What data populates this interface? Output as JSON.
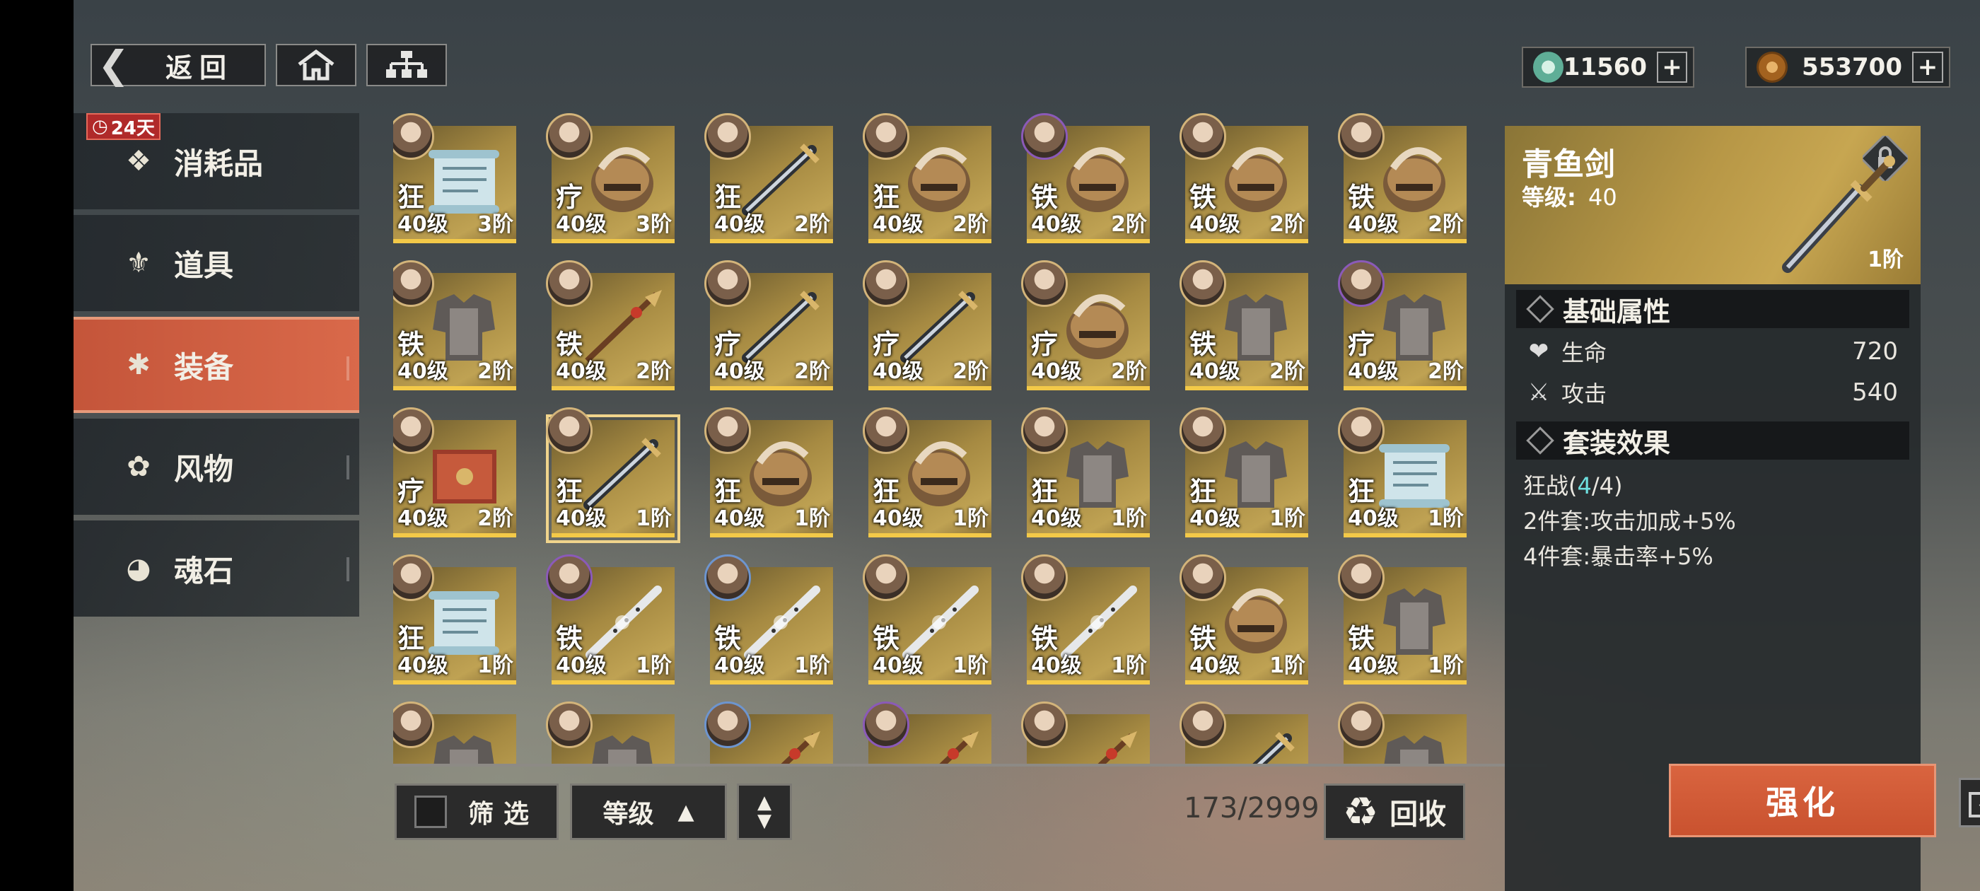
{
  "topbar": {
    "back_label": "返回"
  },
  "currencies": [
    {
      "icon": "jade-icon",
      "value": "11560"
    },
    {
      "icon": "coin-icon",
      "value": "553700"
    }
  ],
  "sidebar": {
    "timer_badge": "24天",
    "items": [
      {
        "label": "消耗品",
        "icon": "consumables-icon"
      },
      {
        "label": "道具",
        "icon": "props-icon"
      },
      {
        "label": "装备",
        "icon": "equipment-icon",
        "active": true
      },
      {
        "label": "风物",
        "icon": "scenery-icon"
      },
      {
        "label": "魂石",
        "icon": "soulstone-icon"
      }
    ]
  },
  "grid": {
    "cards": [
      {
        "set": "狂",
        "level": "40级",
        "tier": "3阶",
        "item": "scroll"
      },
      {
        "set": "疗",
        "level": "40级",
        "tier": "3阶",
        "item": "helmet"
      },
      {
        "set": "狂",
        "level": "40级",
        "tier": "2阶",
        "item": "sword"
      },
      {
        "set": "狂",
        "level": "40级",
        "tier": "2阶",
        "item": "helmet"
      },
      {
        "set": "铁",
        "level": "40级",
        "tier": "2阶",
        "item": "helmet"
      },
      {
        "set": "铁",
        "level": "40级",
        "tier": "2阶",
        "item": "helmet"
      },
      {
        "set": "铁",
        "level": "40级",
        "tier": "2阶",
        "item": "helmet"
      },
      {
        "set": "铁",
        "level": "40级",
        "tier": "2阶",
        "item": "armor"
      },
      {
        "set": "铁",
        "level": "40级",
        "tier": "2阶",
        "item": "spear"
      },
      {
        "set": "疗",
        "level": "40级",
        "tier": "2阶",
        "item": "sword"
      },
      {
        "set": "疗",
        "level": "40级",
        "tier": "2阶",
        "item": "sword"
      },
      {
        "set": "疗",
        "level": "40级",
        "tier": "2阶",
        "item": "helmet"
      },
      {
        "set": "铁",
        "level": "40级",
        "tier": "2阶",
        "item": "armor"
      },
      {
        "set": "疗",
        "level": "40级",
        "tier": "2阶",
        "item": "armor"
      },
      {
        "set": "疗",
        "level": "40级",
        "tier": "2阶",
        "item": "book"
      },
      {
        "set": "狂",
        "level": "40级",
        "tier": "1阶",
        "item": "sword",
        "selected": true
      },
      {
        "set": "狂",
        "level": "40级",
        "tier": "1阶",
        "item": "helmet"
      },
      {
        "set": "狂",
        "level": "40级",
        "tier": "1阶",
        "item": "helmet"
      },
      {
        "set": "狂",
        "level": "40级",
        "tier": "1阶",
        "item": "armor"
      },
      {
        "set": "狂",
        "level": "40级",
        "tier": "1阶",
        "item": "armor"
      },
      {
        "set": "狂",
        "level": "40级",
        "tier": "1阶",
        "item": "scroll"
      },
      {
        "set": "狂",
        "level": "40级",
        "tier": "1阶",
        "item": "scroll"
      },
      {
        "set": "铁",
        "level": "40级",
        "tier": "1阶",
        "item": "flute"
      },
      {
        "set": "铁",
        "level": "40级",
        "tier": "1阶",
        "item": "flute"
      },
      {
        "set": "铁",
        "level": "40级",
        "tier": "1阶",
        "item": "flute"
      },
      {
        "set": "铁",
        "level": "40级",
        "tier": "1阶",
        "item": "flute"
      },
      {
        "set": "铁",
        "level": "40级",
        "tier": "1阶",
        "item": "helmet"
      },
      {
        "set": "铁",
        "level": "40级",
        "tier": "1阶",
        "item": "armor"
      },
      {
        "set": "",
        "level": "",
        "tier": "",
        "item": "armor"
      },
      {
        "set": "",
        "level": "",
        "tier": "",
        "item": "armor"
      },
      {
        "set": "",
        "level": "",
        "tier": "",
        "item": "spear"
      },
      {
        "set": "",
        "level": "",
        "tier": "",
        "item": "spear"
      },
      {
        "set": "",
        "level": "",
        "tier": "",
        "item": "spear"
      },
      {
        "set": "",
        "level": "",
        "tier": "",
        "item": "sword"
      },
      {
        "set": "",
        "level": "",
        "tier": "",
        "item": "armor"
      }
    ]
  },
  "controls": {
    "filter_label": "筛选",
    "sort_label": "等级",
    "count": "173/2999",
    "recycle_label": "回收"
  },
  "detail": {
    "name": "青鱼剑",
    "level_label": "等级:",
    "level_value": "40",
    "tier": "1阶",
    "base_title": "基础属性",
    "attrs": [
      {
        "label": "生命",
        "value": "720",
        "icon": "heart-icon"
      },
      {
        "label": "攻击",
        "value": "540",
        "icon": "crossed-swords-icon"
      }
    ],
    "set_title": "套装效果",
    "set_name": "狂战(",
    "set_current": "4",
    "set_total": "/4)",
    "set_effects": [
      "2件套:攻击加成+5%",
      "4件套:暴击率+5%"
    ],
    "enhance_label": "强化"
  },
  "colors": {
    "accent": "#d9643f",
    "gold": "#f3c948",
    "cyan": "#6ee0df"
  }
}
